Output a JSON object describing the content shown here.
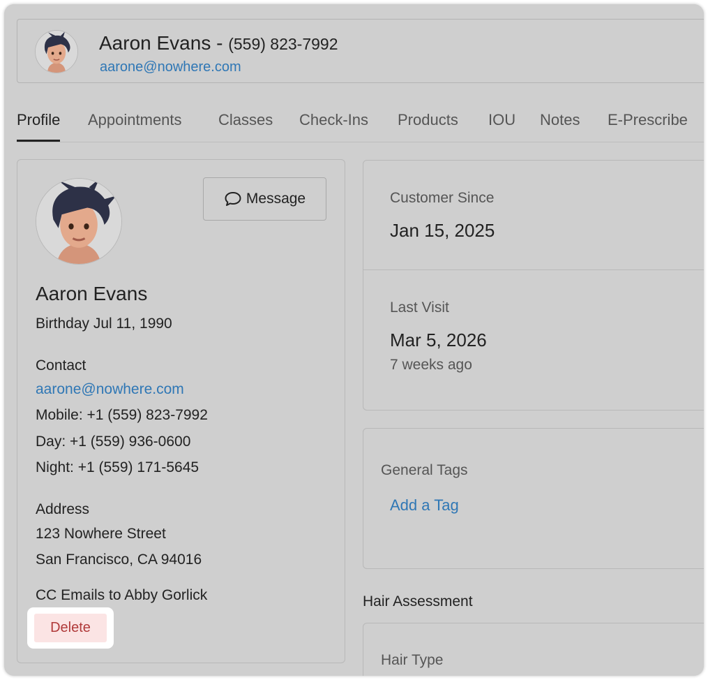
{
  "header": {
    "name": "Aaron Evans",
    "separator": " - ",
    "phone": "(559) 823-7992",
    "email": "aarone@nowhere.com",
    "avatar_icon": "avatar-illustration"
  },
  "tabs": [
    {
      "label": "Profile",
      "active": true
    },
    {
      "label": "Appointments"
    },
    {
      "label": "Classes"
    },
    {
      "label": "Check-Ins"
    },
    {
      "label": "Products"
    },
    {
      "label": "IOU"
    },
    {
      "label": "Notes"
    },
    {
      "label": "E-Prescribe"
    }
  ],
  "profile": {
    "message_label": "Message",
    "message_icon": "chat-bubble-icon",
    "name": "Aaron Evans",
    "birthday": "Birthday Jul 11, 1990",
    "contact_heading": "Contact",
    "email": "aarone@nowhere.com",
    "mobile": "Mobile: +1 (559) 823-7992",
    "day": "Day: +1 (559) 936-0600",
    "night": "Night: +1 (559) 171-5645",
    "address_heading": "Address",
    "address_line1": "123 Nowhere Street",
    "address_line2": "San Francisco, CA 94016",
    "cc_emails": "CC Emails to Abby Gorlick",
    "delete_label": "Delete"
  },
  "stats": {
    "customer_since_label": "Customer Since",
    "customer_since_value": "Jan 15, 2025",
    "last_visit_label": "Last Visit",
    "last_visit_value": "Mar 5, 2026",
    "last_visit_ago": "7 weeks ago"
  },
  "tags": {
    "heading": "General Tags",
    "add_label": "Add a Tag"
  },
  "hair": {
    "section_title": "Hair Assessment",
    "type_label": "Hair Type"
  },
  "colors": {
    "background": "#cfcfcf",
    "link": "#2f77b5",
    "delete_text": "#b03a3a",
    "delete_bg": "#fbe4e4"
  }
}
